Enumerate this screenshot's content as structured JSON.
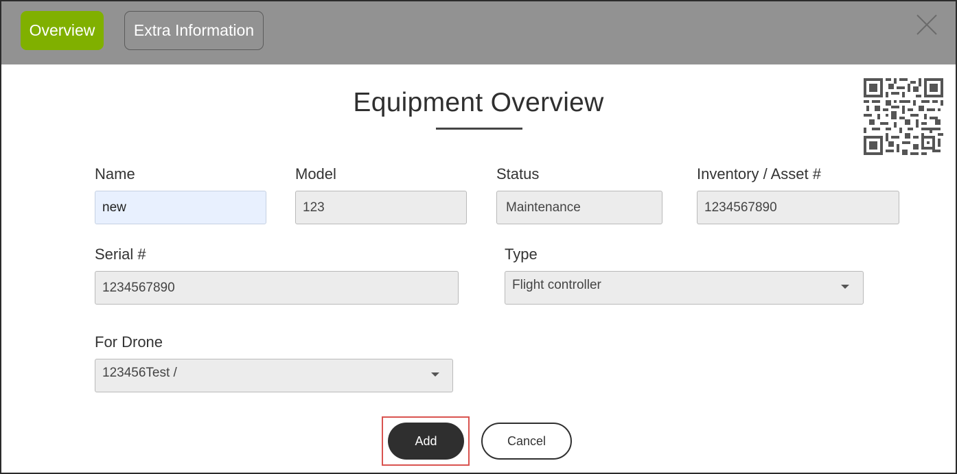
{
  "tabs": [
    {
      "label": "Overview",
      "active": true
    },
    {
      "label": "Extra Information",
      "active": false
    }
  ],
  "page": {
    "title": "Equipment Overview"
  },
  "form": {
    "name": {
      "label": "Name",
      "value": "new"
    },
    "model": {
      "label": "Model",
      "value": "123"
    },
    "status": {
      "label": "Status",
      "value": "Maintenance"
    },
    "inventory": {
      "label": "Inventory / Asset #",
      "value": "1234567890"
    },
    "serial": {
      "label": "Serial #",
      "value": "1234567890"
    },
    "type": {
      "label": "Type",
      "selected": "Flight controller"
    },
    "drone": {
      "label": "For Drone",
      "selected": "123456Test /"
    }
  },
  "actions": {
    "add_label": "Add",
    "cancel_label": "Cancel"
  },
  "colors": {
    "header_bg": "#929292",
    "active_tab": "#80b000",
    "primary_button": "#2f2f2f",
    "highlight_border": "#d9534f"
  },
  "icons": {
    "close": "close-icon",
    "qr": "qr-code-icon",
    "dropdown": "caret-down-icon"
  }
}
